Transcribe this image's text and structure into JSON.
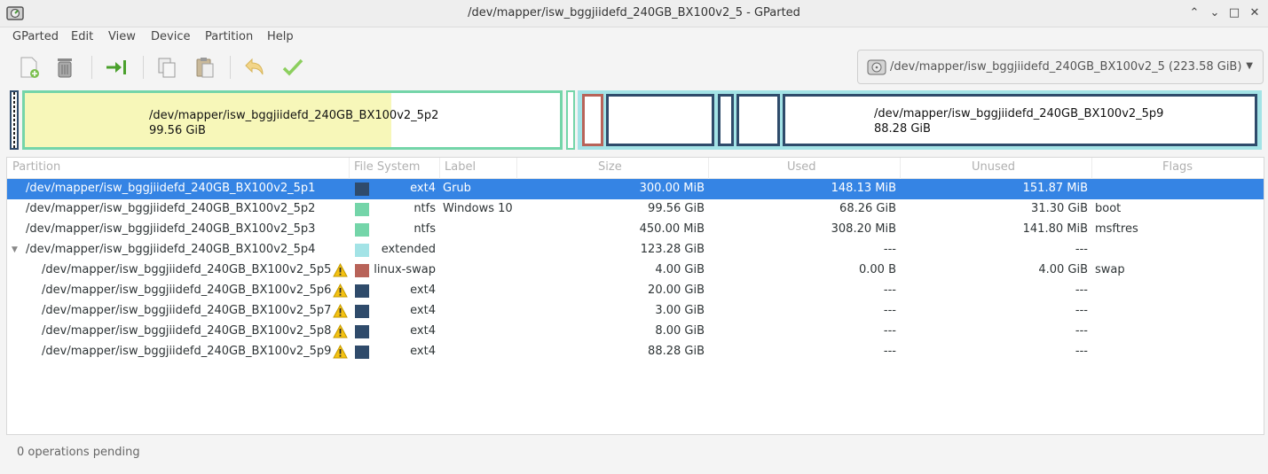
{
  "window": {
    "title": "/dev/mapper/isw_bggjiidefd_240GB_BX100v2_5 - GParted",
    "minimize_glyph": "⌃",
    "maximize_glyph": "⌄",
    "restore_glyph": "□",
    "close_glyph": "✕",
    "app_icon": "gparted-icon"
  },
  "menu": [
    "GParted",
    "Edit",
    "View",
    "Device",
    "Partition",
    "Help"
  ],
  "toolbar": {
    "buttons": [
      "new-partition",
      "delete-partition",
      "resize-move",
      "copy",
      "paste",
      "undo",
      "apply"
    ]
  },
  "device_selector": {
    "value": "/dev/mapper/isw_bggjiidefd_240GB_BX100v2_5 (223.58 GiB)",
    "icon": "harddisk-icon",
    "arrow": "▼"
  },
  "graph": {
    "p2": {
      "name": "/dev/mapper/isw_bggjiidefd_240GB_BX100v2_5p2",
      "size": "99.56 GiB"
    },
    "p9": {
      "name": "/dev/mapper/isw_bggjiidefd_240GB_BX100v2_5p9",
      "size": "88.28 GiB"
    }
  },
  "table": {
    "headers": [
      "Partition",
      "File System",
      "Label",
      "Size",
      "Used",
      "Unused",
      "Flags"
    ],
    "rows": [
      {
        "partition": "/dev/mapper/isw_bggjiidefd_240GB_BX100v2_5p1",
        "color": "#2f4b6b",
        "fs": "ext4",
        "label": "Grub",
        "size": "300.00 MiB",
        "used": "148.13 MiB",
        "unused": "151.87 MiB",
        "flags": ""
      },
      {
        "partition": "/dev/mapper/isw_bggjiidefd_240GB_BX100v2_5p2",
        "color": "#74d5a9",
        "fs": "ntfs",
        "label": "Windows 10",
        "size": "99.56 GiB",
        "used": "68.26 GiB",
        "unused": "31.30 GiB",
        "flags": "boot"
      },
      {
        "partition": "/dev/mapper/isw_bggjiidefd_240GB_BX100v2_5p3",
        "color": "#74d5a9",
        "fs": "ntfs",
        "label": "",
        "size": "450.00 MiB",
        "used": "308.20 MiB",
        "unused": "141.80 MiB",
        "flags": "msftres"
      },
      {
        "partition": "/dev/mapper/isw_bggjiidefd_240GB_BX100v2_5p4",
        "color": "#a3e3e6",
        "fs": "extended",
        "label": "",
        "size": "123.28 GiB",
        "used": "---",
        "unused": "---",
        "flags": "",
        "expander": "▼"
      },
      {
        "partition": "/dev/mapper/isw_bggjiidefd_240GB_BX100v2_5p5",
        "color": "#b86359",
        "fs": "linux-swap",
        "label": "",
        "size": "4.00 GiB",
        "used": "0.00 B",
        "unused": "4.00 GiB",
        "flags": "swap"
      },
      {
        "partition": "/dev/mapper/isw_bggjiidefd_240GB_BX100v2_5p6",
        "color": "#2f4b6b",
        "fs": "ext4",
        "label": "",
        "size": "20.00 GiB",
        "used": "---",
        "unused": "---",
        "flags": ""
      },
      {
        "partition": "/dev/mapper/isw_bggjiidefd_240GB_BX100v2_5p7",
        "color": "#2f4b6b",
        "fs": "ext4",
        "label": "",
        "size": "3.00 GiB",
        "used": "---",
        "unused": "---",
        "flags": ""
      },
      {
        "partition": "/dev/mapper/isw_bggjiidefd_240GB_BX100v2_5p8",
        "color": "#2f4b6b",
        "fs": "ext4",
        "label": "",
        "size": "8.00 GiB",
        "used": "---",
        "unused": "---",
        "flags": ""
      },
      {
        "partition": "/dev/mapper/isw_bggjiidefd_240GB_BX100v2_5p9",
        "color": "#2f4b6b",
        "fs": "ext4",
        "label": "",
        "size": "88.28 GiB",
        "used": "---",
        "unused": "---",
        "flags": ""
      }
    ]
  },
  "status": "0 operations pending"
}
